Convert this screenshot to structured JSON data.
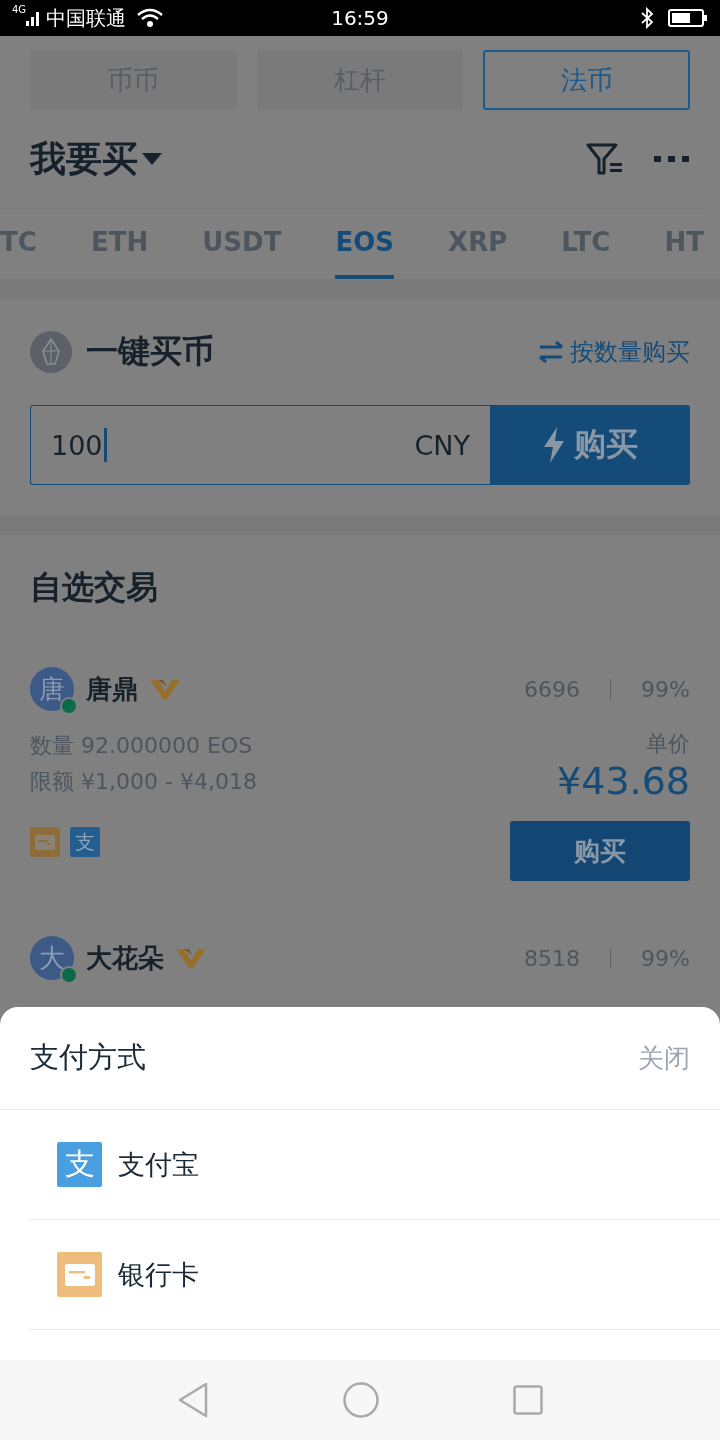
{
  "status_bar": {
    "network": "4G",
    "carrier": "中国联通",
    "time": "16:59"
  },
  "market_tabs": [
    {
      "label": "币币",
      "selected": false
    },
    {
      "label": "杠杆",
      "selected": false
    },
    {
      "label": "法币",
      "selected": true
    }
  ],
  "header": {
    "title": "我要买"
  },
  "coin_tabs": [
    {
      "label": "TC",
      "selected": false
    },
    {
      "label": "ETH",
      "selected": false
    },
    {
      "label": "USDT",
      "selected": false
    },
    {
      "label": "EOS",
      "selected": true
    },
    {
      "label": "XRP",
      "selected": false
    },
    {
      "label": "LTC",
      "selected": false
    },
    {
      "label": "HT",
      "selected": false
    }
  ],
  "quick_buy": {
    "title": "一键买币",
    "toggle": "按数量购买",
    "amount": "100",
    "currency": "CNY",
    "button": "购买"
  },
  "favorites": {
    "title": "自选交易",
    "merchants": [
      {
        "avatar": "唐",
        "name": "唐鼎",
        "online": true,
        "verified": true,
        "orders": "6696",
        "rate": "99%",
        "quantity_label": "数量",
        "quantity": "92.000000  EOS",
        "limit_label": "限额",
        "limit": "¥1,000 - ¥4,018",
        "price_label": "单价",
        "price": "¥43.68",
        "payments": [
          {
            "kind": "bank"
          },
          {
            "kind": "alipay",
            "label": "支"
          }
        ],
        "button": "购买"
      },
      {
        "avatar": "大",
        "name": "大花朵",
        "online": true,
        "verified": true,
        "orders": "8518",
        "rate": "99%"
      }
    ]
  },
  "payment_sheet": {
    "title": "支付方式",
    "close": "关闭",
    "options": [
      {
        "kind": "alipay",
        "icon_label": "支",
        "label": "支付宝"
      },
      {
        "kind": "bank",
        "label": "银行卡"
      }
    ]
  }
}
